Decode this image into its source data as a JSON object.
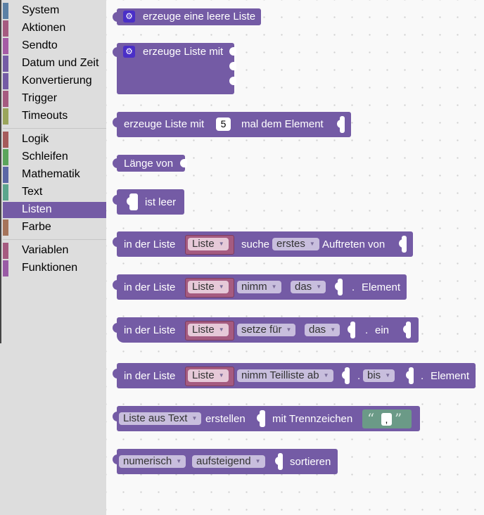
{
  "toolbox": {
    "categories_top": [
      {
        "label": "System",
        "color": "#5b80a5"
      },
      {
        "label": "Aktionen",
        "color": "#a55b80"
      },
      {
        "label": "Sendto",
        "color": "#a55ba5"
      },
      {
        "label": "Datum und Zeit",
        "color": "#745ba5"
      },
      {
        "label": "Konvertierung",
        "color": "#745ba5"
      },
      {
        "label": "Trigger",
        "color": "#a55b80"
      },
      {
        "label": "Timeouts",
        "color": "#9aa55b"
      }
    ],
    "categories_mid": [
      {
        "label": "Logik",
        "color": "#a55b5b"
      },
      {
        "label": "Schleifen",
        "color": "#5ba55b"
      },
      {
        "label": "Mathematik",
        "color": "#5b67a5"
      },
      {
        "label": "Text",
        "color": "#5ba58c"
      },
      {
        "label": "Listen",
        "color": "#745ba5",
        "selected": true
      },
      {
        "label": "Farbe",
        "color": "#a5745b"
      }
    ],
    "categories_bottom": [
      {
        "label": "Variablen",
        "color": "#a55b80"
      },
      {
        "label": "Funktionen",
        "color": "#995ba5"
      }
    ]
  },
  "colors": {
    "list_block": "#745ba5",
    "variable": "#a55b80",
    "text_block": "#6b9a87",
    "workspace": "#f9f9f9",
    "toolbox": "#dddddd"
  },
  "blocks": {
    "create_empty": {
      "label": "erzeuge eine leere Liste",
      "icon": "gear-icon"
    },
    "create_with": {
      "label": "erzeuge Liste mit",
      "icon": "gear-icon"
    },
    "repeat": {
      "label1": "erzeuge Liste mit",
      "count": "5",
      "label2": "mal dem Element"
    },
    "length": {
      "label": "Länge von"
    },
    "is_empty": {
      "label": "ist leer"
    },
    "index_of": {
      "label1": "in der Liste",
      "var": "Liste",
      "label2": "suche",
      "mode": "erstes",
      "label3": "Auftreten von"
    },
    "get_index": {
      "label1": "in der Liste",
      "var": "Liste",
      "mode": "nimm",
      "where": "das",
      "dot": ".",
      "label2": "Element"
    },
    "set_index": {
      "label1": "in der Liste",
      "var": "Liste",
      "mode": "setze für",
      "where": "das",
      "dot": ".",
      "label2": "ein"
    },
    "sublist": {
      "label1": "in der Liste",
      "var": "Liste",
      "mode": "nimm Teilliste ab",
      "dot1": ".",
      "where2": "bis",
      "dot2": ".",
      "label2": "Element"
    },
    "split": {
      "mode": "Liste aus Text",
      "label1": "erstellen",
      "label2": "mit Trennzeichen",
      "open_quote": "“",
      "delim": ",",
      "close_quote": "”"
    },
    "sort": {
      "type": "numerisch",
      "order": "aufsteigend",
      "label": "sortieren"
    }
  }
}
